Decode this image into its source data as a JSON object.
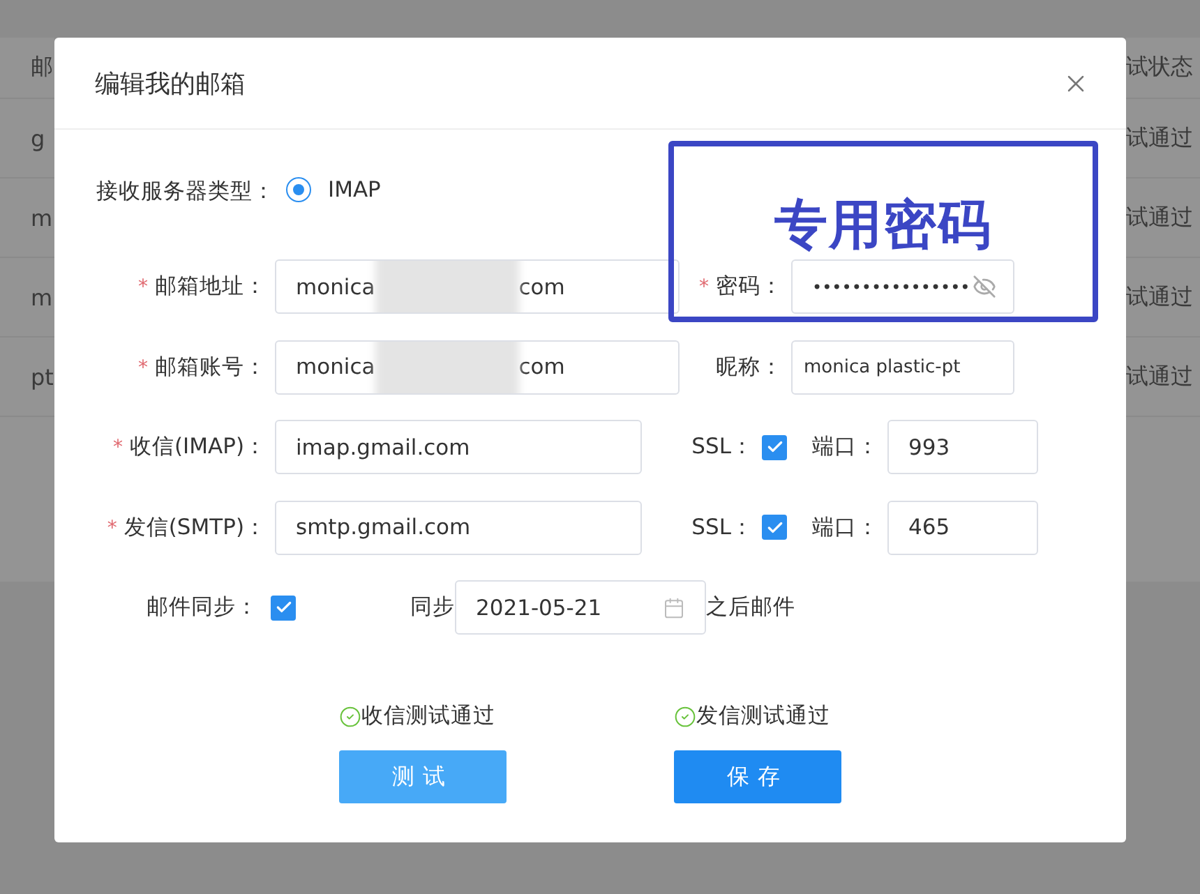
{
  "background_table": {
    "left_header": "邮",
    "left_cells": [
      "g",
      "m",
      "m",
      "pt"
    ],
    "right_header": "试状态",
    "right_cells": [
      "试通过",
      "试通过",
      "试通过",
      "试通过"
    ]
  },
  "dialog": {
    "title": "编辑我的邮箱"
  },
  "server_type": {
    "label": "接收服务器类型：",
    "options": [
      {
        "label": "IMAP",
        "selected": true
      }
    ]
  },
  "email": {
    "mark": "*",
    "label": "邮箱地址：",
    "value_start": "monica",
    "value_end": "com"
  },
  "password": {
    "mark": "*",
    "label": "密码：",
    "value": "••••••••••••••••"
  },
  "account": {
    "mark": "*",
    "label": "邮箱账号：",
    "value_start": "monica",
    "value_end": "com"
  },
  "nickname": {
    "label": "昵称：",
    "value": "monica plastic-pt"
  },
  "servers": [
    {
      "mark": "*",
      "label": "收信(IMAP)：",
      "host": "imap.gmail.com",
      "ssl_label": "SSL：",
      "ssl": true,
      "port_label": "端口：",
      "port": "993"
    },
    {
      "mark": "*",
      "label": "发信(SMTP)：",
      "host": "smtp.gmail.com",
      "ssl_label": "SSL：",
      "ssl": true,
      "port_label": "端口：",
      "port": "465"
    }
  ],
  "sync": {
    "label": "邮件同步：",
    "checked": true,
    "prefix": "同步",
    "date": "2021-05-21",
    "suffix": "之后邮件"
  },
  "tests": [
    {
      "status": "收信测试通过",
      "passed": true,
      "button": "测试",
      "kind": "secondary"
    },
    {
      "status": "发信测试通过",
      "passed": true,
      "button": "保存",
      "kind": "primary"
    }
  ],
  "annotation": {
    "text": "专用密码"
  }
}
